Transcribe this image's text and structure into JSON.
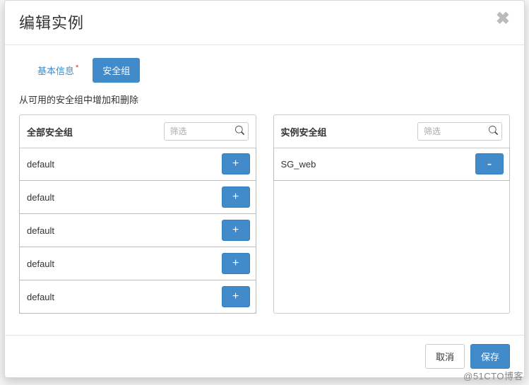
{
  "modal": {
    "title": "编辑实例",
    "close_label": "✖",
    "tabs": [
      {
        "label": "基本信息",
        "asterisk": "*",
        "active": false
      },
      {
        "label": "安全组",
        "active": true
      }
    ],
    "subtitle": "从可用的安全组中增加和删除"
  },
  "available_panel": {
    "title": "全部安全组",
    "filter_placeholder": "筛选",
    "items": [
      {
        "name": "default",
        "action": "+"
      },
      {
        "name": "default",
        "action": "+"
      },
      {
        "name": "default",
        "action": "+"
      },
      {
        "name": "default",
        "action": "+"
      },
      {
        "name": "default",
        "action": "+"
      }
    ]
  },
  "instance_panel": {
    "title": "实例安全组",
    "filter_placeholder": "筛选",
    "items": [
      {
        "name": "SG_web",
        "action": "-"
      }
    ]
  },
  "footer": {
    "cancel": "取消",
    "save": "保存"
  },
  "watermark": "@51CTO博客",
  "colors": {
    "primary": "#428bca",
    "primary_border": "#357ebd",
    "border": "#cccccc",
    "text": "#333333"
  }
}
